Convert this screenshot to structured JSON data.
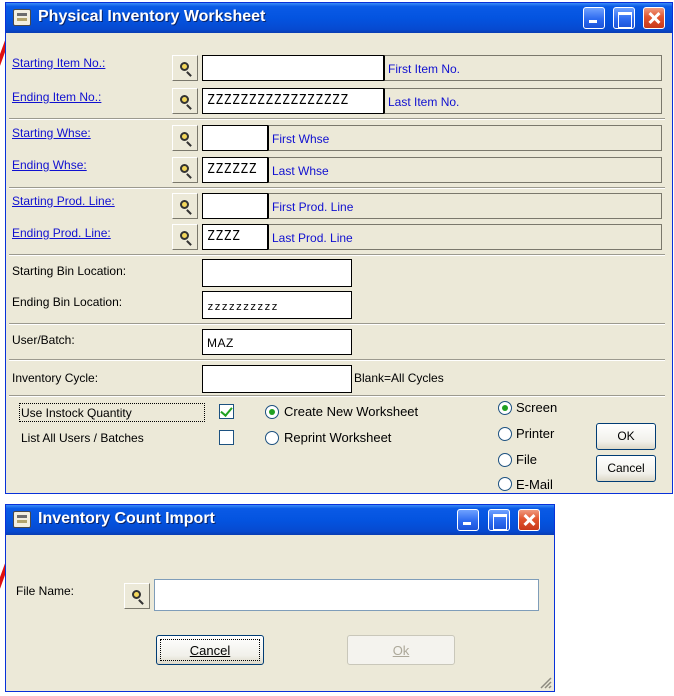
{
  "worksheet": {
    "title": "Physical Inventory Worksheet",
    "starting_item_label": "Starting Item No.:",
    "starting_item_value": "",
    "starting_item_desc": "First Item No.",
    "ending_item_label": "Ending Item No.:",
    "ending_item_value": "ZZZZZZZZZZZZZZZZZ",
    "ending_item_desc": "Last Item No.",
    "starting_whse_label": "Starting Whse:",
    "starting_whse_value": "",
    "starting_whse_desc": "First Whse",
    "ending_whse_label": "Ending Whse:",
    "ending_whse_value": "ZZZZZZ",
    "ending_whse_desc": "Last Whse",
    "starting_prod_label": "Starting Prod. Line:",
    "starting_prod_value": "",
    "starting_prod_desc": "First Prod. Line",
    "ending_prod_label": "Ending Prod. Line:",
    "ending_prod_value": "ZZZZ",
    "ending_prod_desc": "Last Prod. Line",
    "starting_bin_label": "Starting Bin Location:",
    "starting_bin_value": "",
    "ending_bin_label": "Ending Bin Location:",
    "ending_bin_value": "zzzzzzzzzz",
    "user_batch_label": "User/Batch:",
    "user_batch_value": "MAZ",
    "inventory_cycle_label": "Inventory Cycle:",
    "inventory_cycle_value": "",
    "inventory_cycle_hint": "Blank=All Cycles",
    "use_instock_label": "Use Instock Quantity",
    "use_instock_checked": true,
    "list_all_users_label": "List All Users / Batches",
    "list_all_users_checked": false,
    "create_new_label": "Create New Worksheet",
    "reprint_label": "Reprint Worksheet",
    "worksheet_mode_selected": "Create New Worksheet",
    "output_screen": "Screen",
    "output_printer": "Printer",
    "output_file": "File",
    "output_email": "E-Mail",
    "output_selected": "Screen",
    "ok_label": "OK",
    "cancel_label": "Cancel"
  },
  "import_dialog": {
    "title": "Inventory Count Import",
    "file_name_label": "File Name:",
    "file_name_value": "",
    "cancel_label": "Cancel",
    "ok_label": "Ok"
  },
  "icons": [
    "app-window-icon",
    "search-icon",
    "minimize-icon",
    "maximize-icon",
    "close-icon",
    "resize-grip-icon"
  ],
  "colors": {
    "titlebar_blue": "#0454e0",
    "window_face": "#ece9d8",
    "link_blue": "#1010d0",
    "close_red": "#e2552f",
    "check_green": "#21a121"
  }
}
